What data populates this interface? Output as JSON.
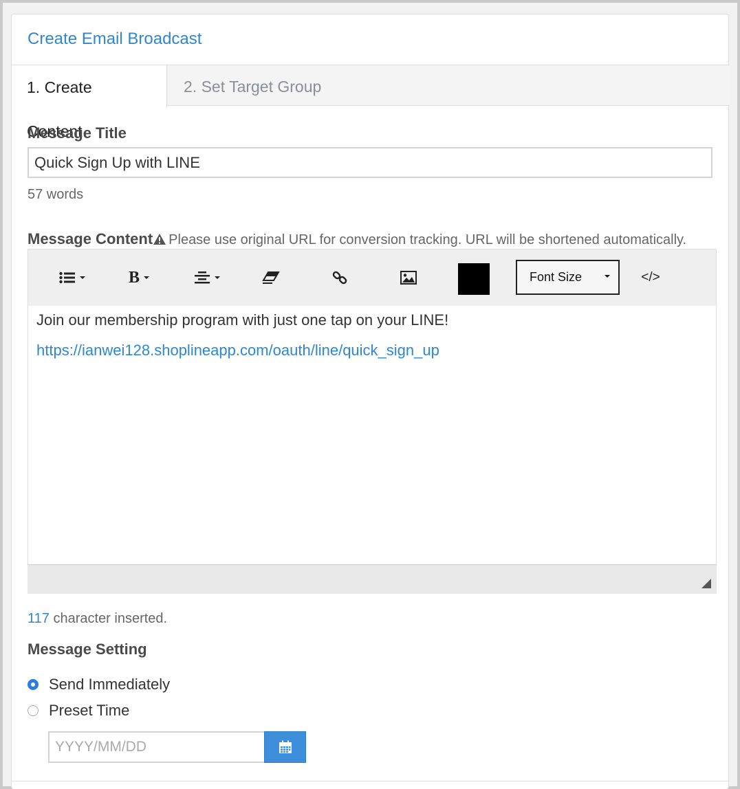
{
  "panel": {
    "title": "Create Email Broadcast"
  },
  "tabs": [
    {
      "label": "1. Create Content",
      "active": true
    },
    {
      "label": "2. Set Target Group",
      "active": false
    }
  ],
  "message_title": {
    "label": "Message Title",
    "value": "Quick Sign Up with LINE",
    "word_count": "57 words"
  },
  "message_content": {
    "label": "Message Content",
    "warning": "Please use original URL for conversion tracking. URL will be shortened automatically.",
    "toolbar": {
      "icons": [
        "list-icon",
        "bold-icon",
        "align-center-icon",
        "eraser-icon",
        "link-icon",
        "image-icon",
        "color-swatch",
        "code-view-icon"
      ],
      "bold_glyph": "B",
      "font_size_label": "Font Size",
      "code_label": "</>",
      "color": "#000000"
    },
    "body_line": "Join our membership program with just one tap on your LINE!",
    "body_link": "https://ianwei128.shoplineapp.com/oauth/line/quick_sign_up"
  },
  "char_count": {
    "number": "117",
    "suffix": " character inserted."
  },
  "message_setting": {
    "label": "Message Setting",
    "options": [
      {
        "label": "Send Immediately",
        "checked": true
      },
      {
        "label": "Preset Time",
        "checked": false
      }
    ],
    "date_placeholder": "YYYY/MM/DD"
  },
  "colors": {
    "accent": "#2f86d1",
    "radio_checked": "#2f7de1",
    "calendar_button": "#3d8fdc"
  }
}
